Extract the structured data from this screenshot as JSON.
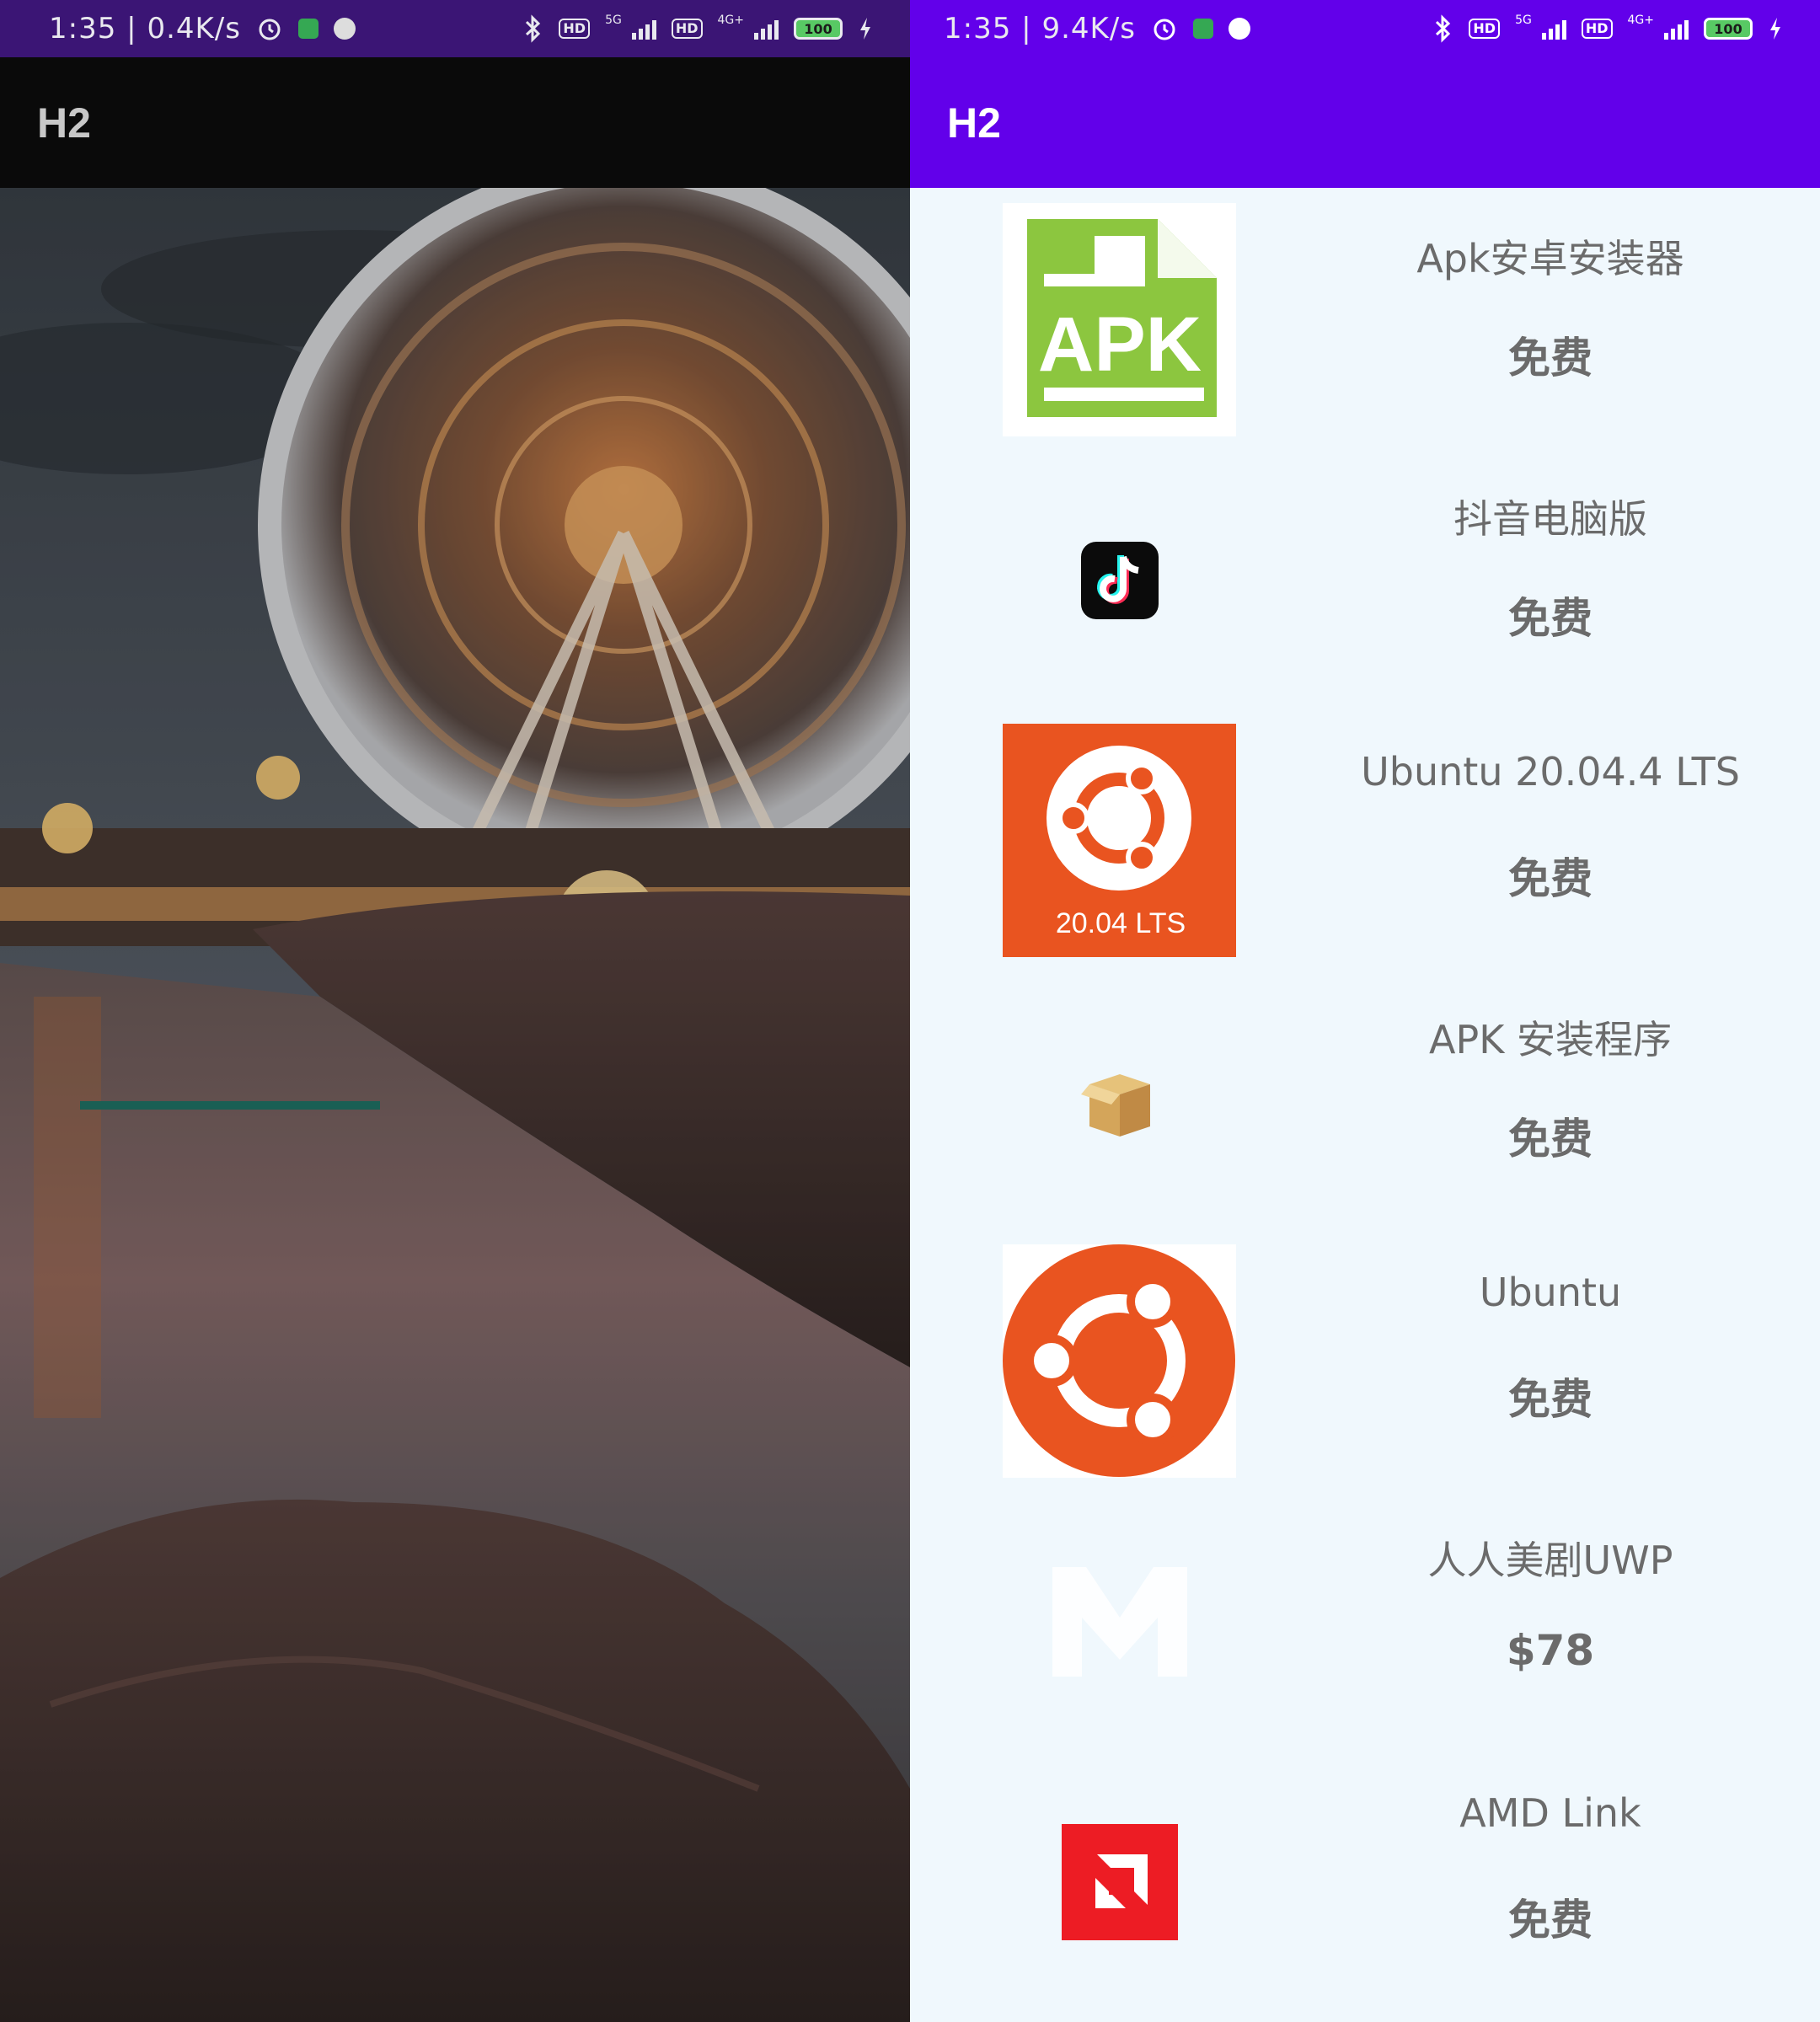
{
  "left_screen": {
    "status_bar": {
      "time": "1:35",
      "net_speed": "0.4K/s",
      "network_1": "5G",
      "network_2": "4G+",
      "hd_badge": "HD",
      "battery": "100"
    },
    "app_bar": {
      "title": "H2"
    },
    "loading_progress": 0.33
  },
  "right_screen": {
    "status_bar": {
      "time": "1:35",
      "net_speed": "9.4K/s",
      "network_1": "5G",
      "network_2": "4G+",
      "hd_badge": "HD",
      "battery": "100"
    },
    "app_bar": {
      "title": "H2"
    },
    "apps": [
      {
        "name": "Apk安卓安装器",
        "price": "免费",
        "icon": "apk-icon",
        "icon_text": "APK"
      },
      {
        "name": "抖音电脑版",
        "price": "免费",
        "icon": "tiktok-icon"
      },
      {
        "name": "Ubuntu 20.04.4 LTS",
        "price": "免费",
        "icon": "ubuntu-lts-icon",
        "icon_text": "20.04 LTS"
      },
      {
        "name": "APK 安装程序",
        "price": "免费",
        "icon": "package-box-icon"
      },
      {
        "name": "Ubuntu",
        "price": "免费",
        "icon": "ubuntu-icon"
      },
      {
        "name": "人人美剧UWP",
        "price": "$78",
        "icon": "m-logo-icon"
      },
      {
        "name": "AMD Link",
        "price": "免费",
        "icon": "amd-icon"
      }
    ]
  },
  "colors": {
    "left_status_bar": "#3b1575",
    "right_primary": "#6200ea",
    "list_background": "#f0f8fd",
    "text_gray": "#6b6b6b",
    "apk_green": "#8cc63f",
    "ubuntu_orange": "#e95420",
    "amd_red": "#ed1c24",
    "progress_teal": "#1a5f54"
  }
}
